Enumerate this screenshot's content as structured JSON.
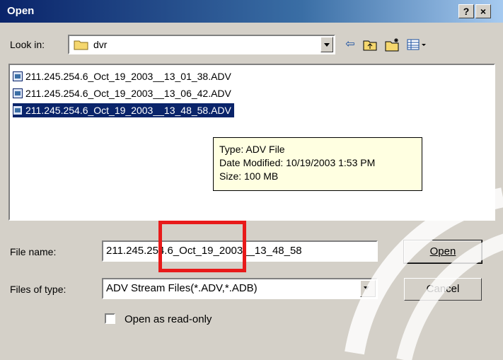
{
  "window": {
    "title": "Open",
    "help_btn": "?",
    "close_btn": "×"
  },
  "look_in": {
    "label": "Look in:",
    "value": "dvr"
  },
  "toolbar": [
    {
      "name": "back-icon",
      "glyph": "⇦"
    },
    {
      "name": "up-folder-icon",
      "glyph": "⮤"
    },
    {
      "name": "new-folder-icon",
      "glyph": "✳"
    },
    {
      "name": "view-menu-icon",
      "glyph": "▦"
    }
  ],
  "files": [
    "211.245.254.6_Oct_19_2003__13_01_38.ADV",
    "211.245.254.6_Oct_19_2003__13_06_42.ADV",
    "211.245.254.6_Oct_19_2003__13_48_58.ADV"
  ],
  "tooltip": {
    "type": "Type: ADV File",
    "modified": "Date Modified: 10/19/2003 1:53 PM",
    "size": "Size: 100 MB"
  },
  "file_name": {
    "label": "File name:",
    "value": "211.245.254.6_Oct_19_2003__13_48_58"
  },
  "file_type": {
    "label": "Files of type:",
    "value": "ADV Stream Files(*.ADV,*.ADB)"
  },
  "buttons": {
    "open": "Open",
    "cancel": "Cancel"
  },
  "readonly": {
    "label": "Open as read-only",
    "checked": false
  },
  "colors": {
    "selection": "#0a246a",
    "highlight_box": "#e81a1a",
    "tooltip_bg": "#ffffe1"
  }
}
